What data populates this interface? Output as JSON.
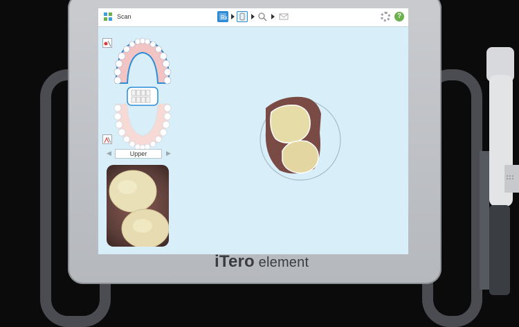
{
  "app": {
    "title": "Scan"
  },
  "toolbar": {
    "steps": [
      {
        "icon": "rx-icon",
        "active": false
      },
      {
        "icon": "scan-icon",
        "active": true
      },
      {
        "icon": "view-icon",
        "active": false
      },
      {
        "icon": "send-icon",
        "active": false
      }
    ],
    "settings_icon": "gear-icon",
    "help_label": "?"
  },
  "sidebar": {
    "arch_label": "Upper"
  },
  "device": {
    "brand_main": "iTero",
    "brand_sub": " element"
  },
  "colors": {
    "screen_bg": "#d8eef8",
    "accent_blue": "#1e78c8",
    "help_green": "#6ab04c"
  }
}
